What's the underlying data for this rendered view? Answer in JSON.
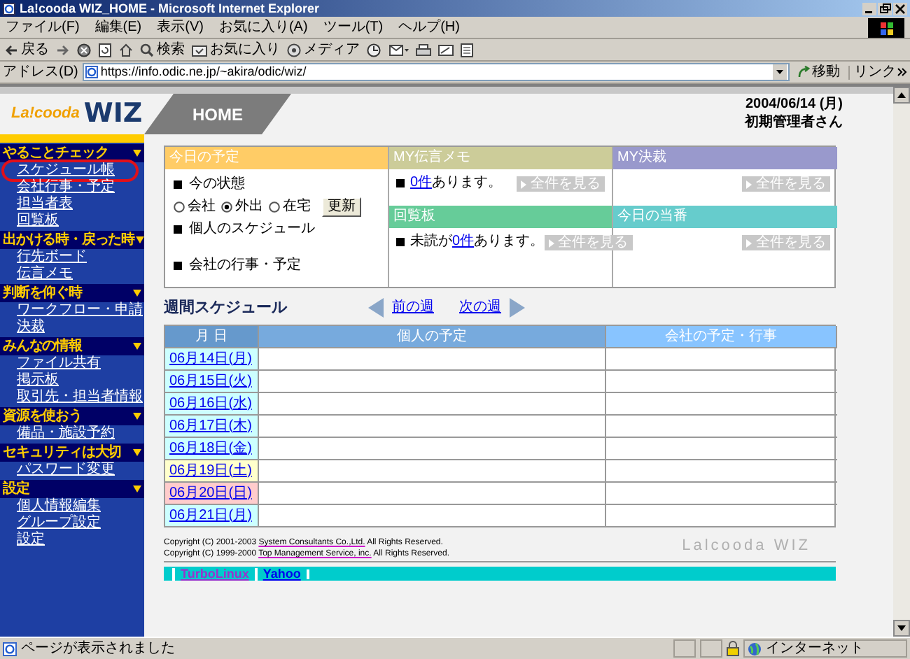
{
  "window": {
    "title": "La!cooda WIZ_HOME - Microsoft Internet Explorer"
  },
  "menu": [
    "ファイル(F)",
    "編集(E)",
    "表示(V)",
    "お気に入り(A)",
    "ツール(T)",
    "ヘルプ(H)"
  ],
  "toolbar": [
    {
      "kind": "back",
      "label": "戻る"
    },
    {
      "kind": "forward"
    },
    {
      "kind": "stop"
    },
    {
      "kind": "refresh"
    },
    {
      "kind": "home"
    },
    {
      "kind": "search",
      "label": "検索"
    },
    {
      "kind": "favorites",
      "label": "お気に入り"
    },
    {
      "kind": "media",
      "label": "メディア"
    },
    {
      "kind": "history"
    },
    {
      "kind": "mail"
    },
    {
      "kind": "print"
    },
    {
      "kind": "edit"
    },
    {
      "kind": "discuss"
    }
  ],
  "address_bar": {
    "label": "アドレス(D)",
    "url": "https://info.odic.ne.jp/~akira/odic/wiz/",
    "go": "移動",
    "links": "リンク"
  },
  "header": {
    "logo_text": "La!cooda",
    "logo_wiz": "WIZ",
    "page": "HOME",
    "date": "2004/06/14 (月)",
    "user": "初期管理者さん"
  },
  "sidebar": [
    {
      "title": "やることチェック",
      "items": [
        {
          "label": "スケジュール帳",
          "circled": true
        },
        {
          "label": "会社行事・予定",
          "circled": false
        },
        {
          "label": "担当者表",
          "circled": false
        },
        {
          "label": "回覧板",
          "circled": false
        }
      ]
    },
    {
      "title": "出かける時・戻った時",
      "items": [
        {
          "label": "行先ボード",
          "circled": false
        },
        {
          "label": "伝言メモ",
          "circled": false
        }
      ]
    },
    {
      "title": "判断を仰ぐ時",
      "items": [
        {
          "label": "ワークフロー・申請",
          "circled": false
        },
        {
          "label": "決裁",
          "circled": false
        }
      ]
    },
    {
      "title": "みんなの情報",
      "items": [
        {
          "label": "ファイル共有",
          "circled": false
        },
        {
          "label": "掲示板",
          "circled": false
        },
        {
          "label": "取引先・担当者情報",
          "circled": false
        }
      ]
    },
    {
      "title": "資源を使おう",
      "items": [
        {
          "label": "備品・施設予約",
          "circled": false
        }
      ]
    },
    {
      "title": "セキュリティは大切",
      "items": [
        {
          "label": "パスワード変更",
          "circled": false
        }
      ]
    },
    {
      "title": "設定",
      "items": [
        {
          "label": "個人情報編集",
          "circled": false
        },
        {
          "label": "グループ設定",
          "circled": false
        },
        {
          "label": "設定",
          "circled": false
        }
      ]
    }
  ],
  "today": {
    "title": "今日の予定",
    "color": "#ffcc66",
    "status_heading": "今の状態",
    "status_options": [
      {
        "label": "会社",
        "selected": false
      },
      {
        "label": "外出",
        "selected": true
      },
      {
        "label": "在宅",
        "selected": false
      }
    ],
    "update_button": "更新",
    "personal_heading": "個人のスケジュール",
    "company_heading": "会社の行事・予定"
  },
  "panels": [
    {
      "title": "MY伝言メモ",
      "color": "#cccc99",
      "link": "0件",
      "after": "あります。",
      "button": "全件を見る"
    },
    {
      "title": "MY決裁",
      "color": "#9999cc",
      "button": "全件を見る"
    },
    {
      "title": "回覧板",
      "color": "#66cc99",
      "before": "未読が",
      "link": "0件",
      "after": "あります。",
      "button": "全件を見る"
    },
    {
      "title": "今日の当番",
      "color": "#66cccc",
      "button": "全件を見る"
    }
  ],
  "schedule": {
    "title": "週間スケジュール",
    "prev": "前の週",
    "next": "次の週",
    "columns": [
      "月 日",
      "個人の予定",
      "会社の予定・行事"
    ],
    "rows": [
      {
        "date": "06月14日(月)",
        "color": "#ccffff"
      },
      {
        "date": "06月15日(火)",
        "color": "#ccffff"
      },
      {
        "date": "06月16日(水)",
        "color": "#ccffff"
      },
      {
        "date": "06月17日(木)",
        "color": "#ccffff"
      },
      {
        "date": "06月18日(金)",
        "color": "#ccffff"
      },
      {
        "date": "06月19日(土)",
        "color": "#ffffcc"
      },
      {
        "date": "06月20日(日)",
        "color": "#ffcccc"
      },
      {
        "date": "06月21日(月)",
        "color": "#ccffff"
      }
    ]
  },
  "footer": {
    "copyright": [
      {
        "before": "Copyright (C) 2001-2003 ",
        "link": "System Consultants Co.,Ltd.",
        "after": " All Rights Reserved."
      },
      {
        "before": "Copyright (C) 1999-2000 ",
        "link": "Top Management Service, inc.",
        "after": " All Rights Reserved."
      }
    ],
    "brand": "Lalcooda WIZ",
    "links": [
      "TurboLinux",
      "Yahoo"
    ]
  },
  "status_bar": {
    "message": "ページが表示されました",
    "zone": "インターネット"
  }
}
